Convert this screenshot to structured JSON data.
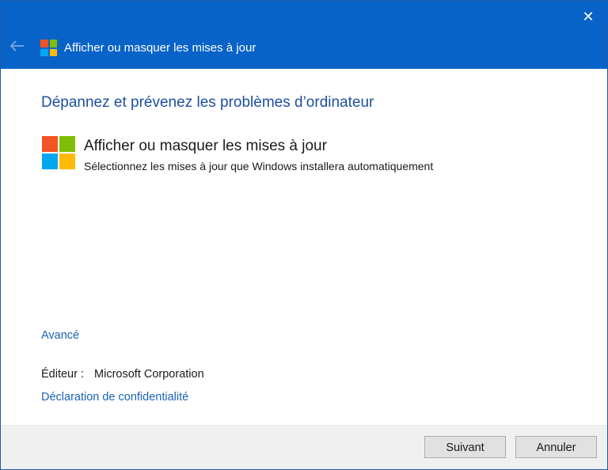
{
  "window": {
    "title": "Afficher ou masquer les mises à jour",
    "close_glyph": "✕",
    "back_glyph": "🡐"
  },
  "main": {
    "heading": "Dépannez et prévenez les problèmes d’ordinateur",
    "option": {
      "title": "Afficher ou masquer les mises à jour",
      "description": "Sélectionnez les mises à jour que Windows installera automatiquement"
    },
    "advanced_link": "Avancé",
    "publisher_label": "Éditeur :",
    "publisher_value": "Microsoft Corporation",
    "privacy_link": "Déclaration de confidentialité"
  },
  "footer": {
    "next_label": "Suivant",
    "cancel_label": "Annuler"
  },
  "icons": {
    "logo": "windows-logo-icon",
    "close": "close-icon",
    "back": "back-arrow-icon"
  },
  "colors": {
    "titlebar": "#0863c8",
    "heading": "#1e4fa0",
    "link": "#1c62b6",
    "logo_red": "#f35325",
    "logo_green": "#81bc06",
    "logo_blue": "#05a6f0",
    "logo_yellow": "#ffba08"
  }
}
